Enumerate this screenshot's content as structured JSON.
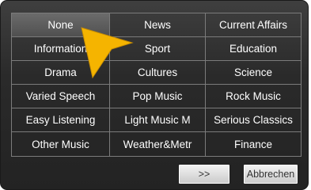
{
  "genres": [
    "None",
    "News",
    "Current Affairs",
    "Information",
    "Sport",
    "Education",
    "Drama",
    "Cultures",
    "Science",
    "Varied Speech",
    "Pop Music",
    "Rock Music",
    "Easy Listening",
    "Light Music M",
    "Serious Classics",
    "Other Music",
    "Weather&Metr",
    "Finance"
  ],
  "selected_genre": "None",
  "buttons": {
    "next_label": ">>",
    "cancel_label": "Abbrechen"
  },
  "pointer_icon": "arrow-cursor-icon",
  "colors": {
    "panel": "#2a2a2a",
    "grid_line": "#7b7b7b",
    "text": "#ffffff",
    "pointer": "#f5b400"
  }
}
